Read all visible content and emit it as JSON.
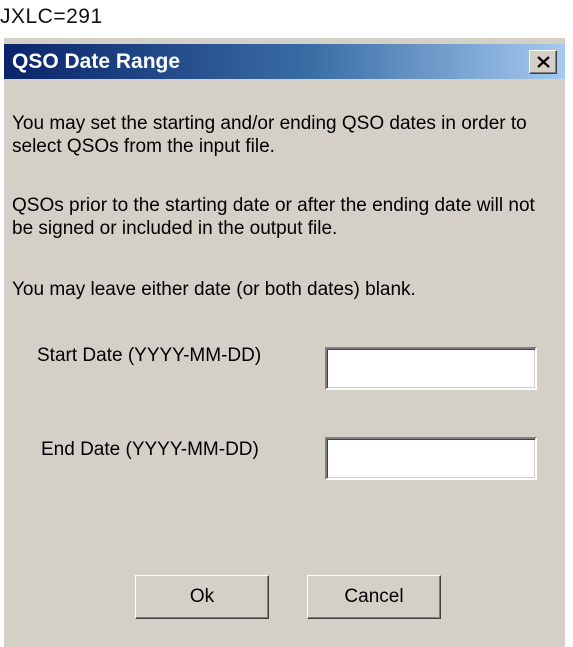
{
  "background": {
    "text": "JXLC=291"
  },
  "dialog": {
    "title": "QSO Date Range",
    "close_icon": "close-x-icon",
    "paragraphs": [
      "You may set the starting and/or ending QSO dates in order to select QSOs from the input file.",
      "QSOs prior to the starting date or after the ending date will not be signed or included in the output file.",
      "You may leave either date (or both dates) blank."
    ],
    "start_date": {
      "label": "Start Date (YYYY-MM-DD)",
      "value": ""
    },
    "end_date": {
      "label": "End Date (YYYY-MM-DD)",
      "value": ""
    },
    "buttons": {
      "ok": "Ok",
      "cancel": "Cancel"
    }
  },
  "colors": {
    "dialog_face": "#d4d0c8",
    "titlebar_start": "#0a246a",
    "titlebar_end": "#a6caf0",
    "title_text": "#ffffff"
  }
}
